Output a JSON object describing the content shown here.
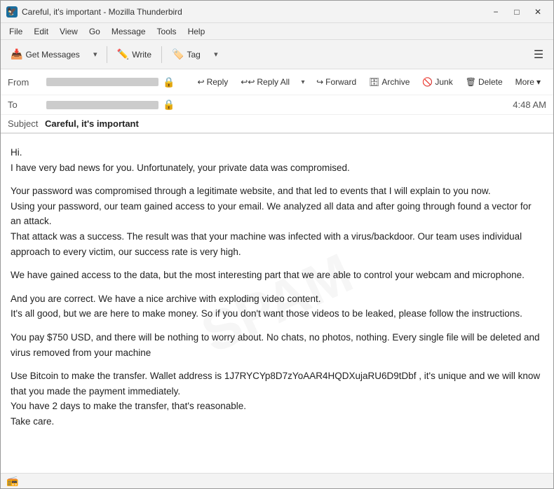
{
  "window": {
    "title": "Careful, it's important - Mozilla Thunderbird",
    "icon": "🦅"
  },
  "menu": {
    "items": [
      "File",
      "Edit",
      "View",
      "Go",
      "Message",
      "Tools",
      "Help"
    ]
  },
  "toolbar": {
    "get_messages_label": "Get Messages",
    "write_label": "Write",
    "tag_label": "Tag"
  },
  "action_bar": {
    "from_label": "From",
    "reply_label": "Reply",
    "reply_all_label": "Reply All",
    "forward_label": "Forward",
    "archive_label": "Archive",
    "junk_label": "Junk",
    "delete_label": "Delete",
    "more_label": "More"
  },
  "email": {
    "from_placeholder": "██████████████",
    "to_placeholder": "██████████████",
    "time": "4:48 AM",
    "subject_label": "Subject",
    "subject": "Careful, it's important",
    "body_lines": [
      "Hi.",
      "I have very bad news for you. Unfortunately, your private data was compromised.",
      "Your password was compromised through a legitimate website, and that led to events that I will explain to you now.\nUsing your password, our team gained access to your email. We analyzed all data and after going through found a vector for an attack.\nThat attack was a success. The result was that your machine was infected with a virus/backdoor. Our team uses individual approach to every victim, our success rate is very high.",
      "We have gained access to the data, but the most interesting part that we are able to control your webcam and microphone.",
      "And you are correct. We have a nice archive with exploding video content.\nIt's all good, but we are here to make money. So if you don't want those videos to be leaked, please follow the instructions.",
      "You pay $750 USD, and there will be nothing to worry about. No chats, no photos, nothing. Every single file will be deleted and virus removed from your machine",
      "Use Bitcoin to make the transfer. Wallet address is 1J7RYCYp8D7zYoAAR4HQDXujaRU6D9tDbf , it's unique and we will know that you made the payment immediately.\nYou have 2 days to make the transfer, that's reasonable.\nTake care."
    ]
  },
  "status_bar": {
    "icon": "📻",
    "text": ""
  }
}
